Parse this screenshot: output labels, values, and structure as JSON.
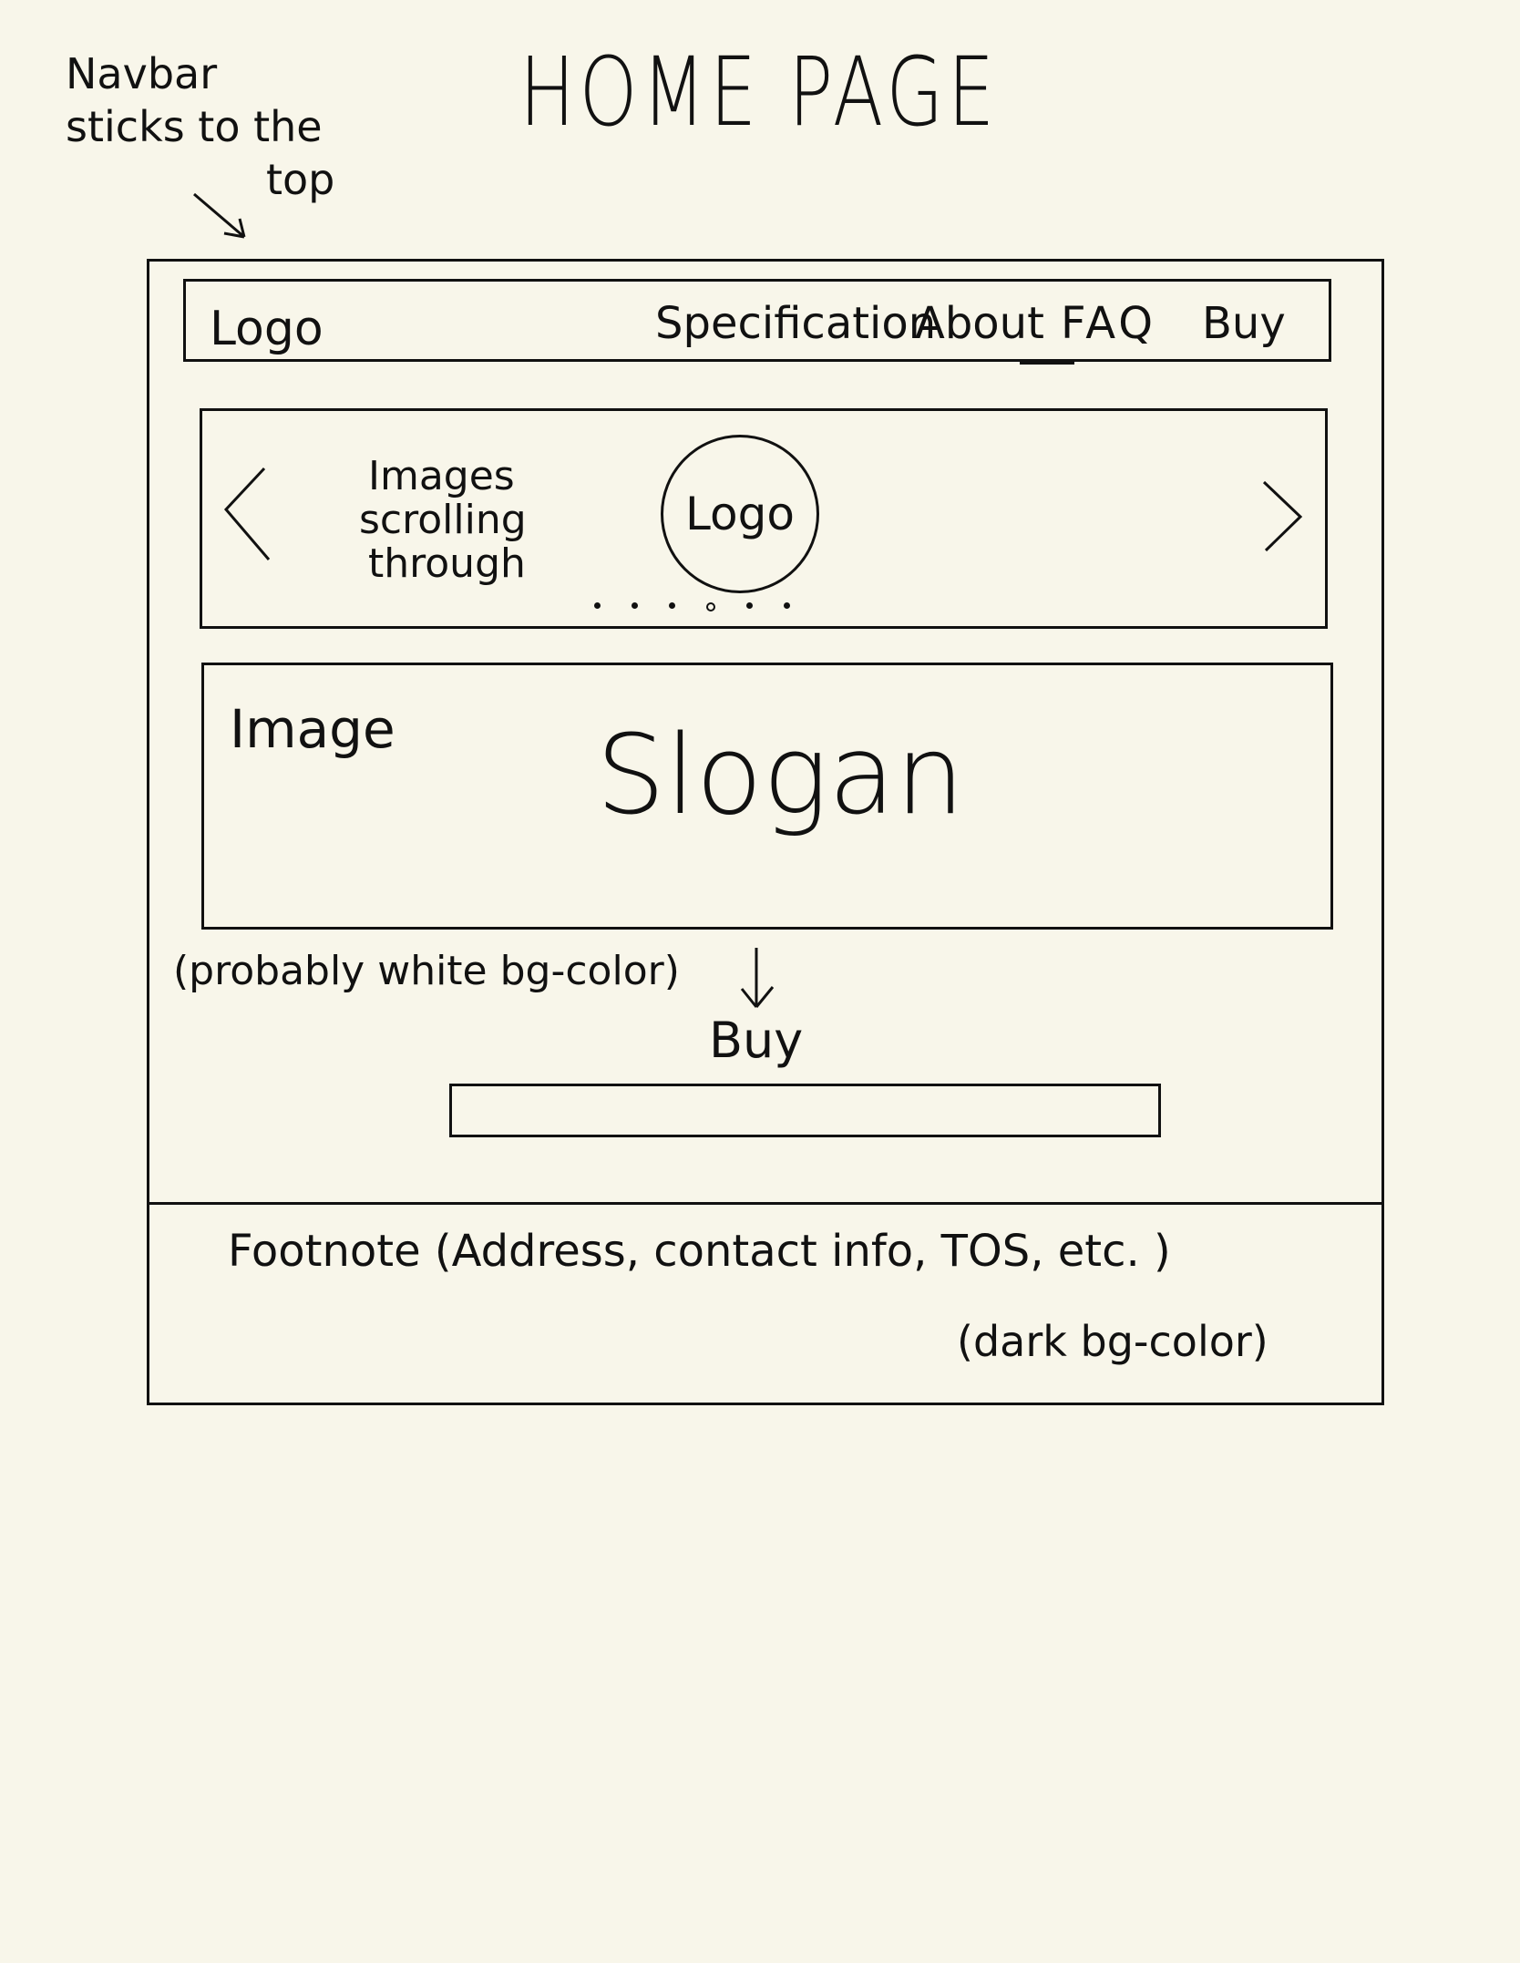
{
  "page_title": "HOME PAGE",
  "annotations": {
    "navbar_note_line1": "Navbar",
    "navbar_note_line2": "sticks to the",
    "navbar_note_line3": "top",
    "hero_bg_note": "(probably white bg-color)",
    "footer_bg_note": "(dark bg-color)"
  },
  "navbar": {
    "logo": "Logo",
    "links": [
      "Specification",
      "About",
      "FAQ",
      "Buy"
    ]
  },
  "carousel": {
    "text_line1": "Images",
    "text_line2": "scrolling",
    "text_line3": "through",
    "logo": "Logo",
    "dot_count": 6
  },
  "hero": {
    "image_label": "Image",
    "slogan": "Slogan"
  },
  "buy_section": {
    "label": "Buy"
  },
  "footer": {
    "text": "Footnote (Address, contact info, TOS, etc. )"
  },
  "colors": {
    "paper": "#F8F6EA",
    "ink": "#111111"
  }
}
